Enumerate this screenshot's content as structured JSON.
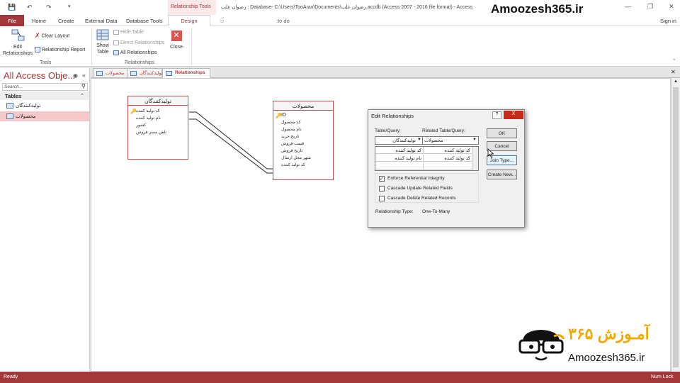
{
  "title_bar": {
    "context_tab": "Relationship Tools",
    "title": "رضوان علب : Database- C:\\Users\\TooArax\\Documents\\رضوان علب.accdb (Access 2007 - 2016 file format) - Access",
    "watermark": "Amoozesh365.ir"
  },
  "tabs": {
    "file": "File",
    "home": "Home",
    "create": "Create",
    "external": "External Data",
    "dbtools": "Database Tools",
    "design": "Design",
    "tellme": ":to do",
    "signin": "Sign in"
  },
  "ribbon": {
    "edit_relationships": "Edit\nRelationships",
    "edit_line1": "Edit",
    "edit_line2": "Relationships",
    "clear_layout": "Clear Layout",
    "relationship_report": "Relationship Report",
    "tools_group": "Tools",
    "show_table_line1": "Show",
    "show_table_line2": "Table",
    "hide_table": "Hide Table",
    "direct_relationships": "Direct Relationships",
    "all_relationships": "All Relationships",
    "close": "Close",
    "relationships_group": "Relationships"
  },
  "nav": {
    "title": "All Access Obje...",
    "search_placeholder": "Search...",
    "section": "Tables",
    "items": [
      {
        "label": "تولیدکنندگان"
      },
      {
        "label": "محصولات"
      }
    ]
  },
  "doc_tabs": [
    {
      "label": "محصولات"
    },
    {
      "label": "تولیدکنندگان"
    },
    {
      "label": "Relationships"
    }
  ],
  "tables": {
    "producers": {
      "title": "تولیدکنندگان",
      "fields": [
        "کد تولید کننده",
        "نام تولید کننده",
        "کشور",
        "تلفن مسر فروش"
      ]
    },
    "products": {
      "title": "محصولات",
      "fields": [
        "ID",
        "کد محصول",
        "نام محصول",
        "تاریخ خرید",
        "قیمت فروش",
        "تاریخ فروش",
        "شهر محل ارسال",
        "کد تولید کننده"
      ]
    }
  },
  "dialog": {
    "title": "Edit Relationships",
    "help": "?",
    "close": "X",
    "table_query_label": "Table/Query:",
    "related_label": "Related Table/Query:",
    "table_value": "تولیدکنندگان",
    "related_value": "محصولات",
    "grid_rows": [
      {
        "left": "کد تولید کننده",
        "right": "کد تولید کننده"
      },
      {
        "left": "نام تولید کننده",
        "right": "کد تولید کننده"
      },
      {
        "left": "",
        "right": ""
      }
    ],
    "enforce": "Enforce Referential Integrity",
    "enforce_checked": true,
    "cascade_update": "Cascade Update Related Fields",
    "cascade_delete": "Cascade Delete Related Records",
    "rel_type_label": "Relationship Type:",
    "rel_type_value": "One-To-Many",
    "ok": "OK",
    "cancel": "Cancel",
    "join_type": "Join Type...",
    "create_new": "Create New..."
  },
  "status": {
    "left": "Ready",
    "right": "Num Lock"
  },
  "watermark_bottom": {
    "text": "Amoozesh365.ir",
    "fa_text": "آمـوزش ۳۶۵"
  },
  "colors": {
    "accent": "#a4373a",
    "table_border": "#c0504d"
  }
}
